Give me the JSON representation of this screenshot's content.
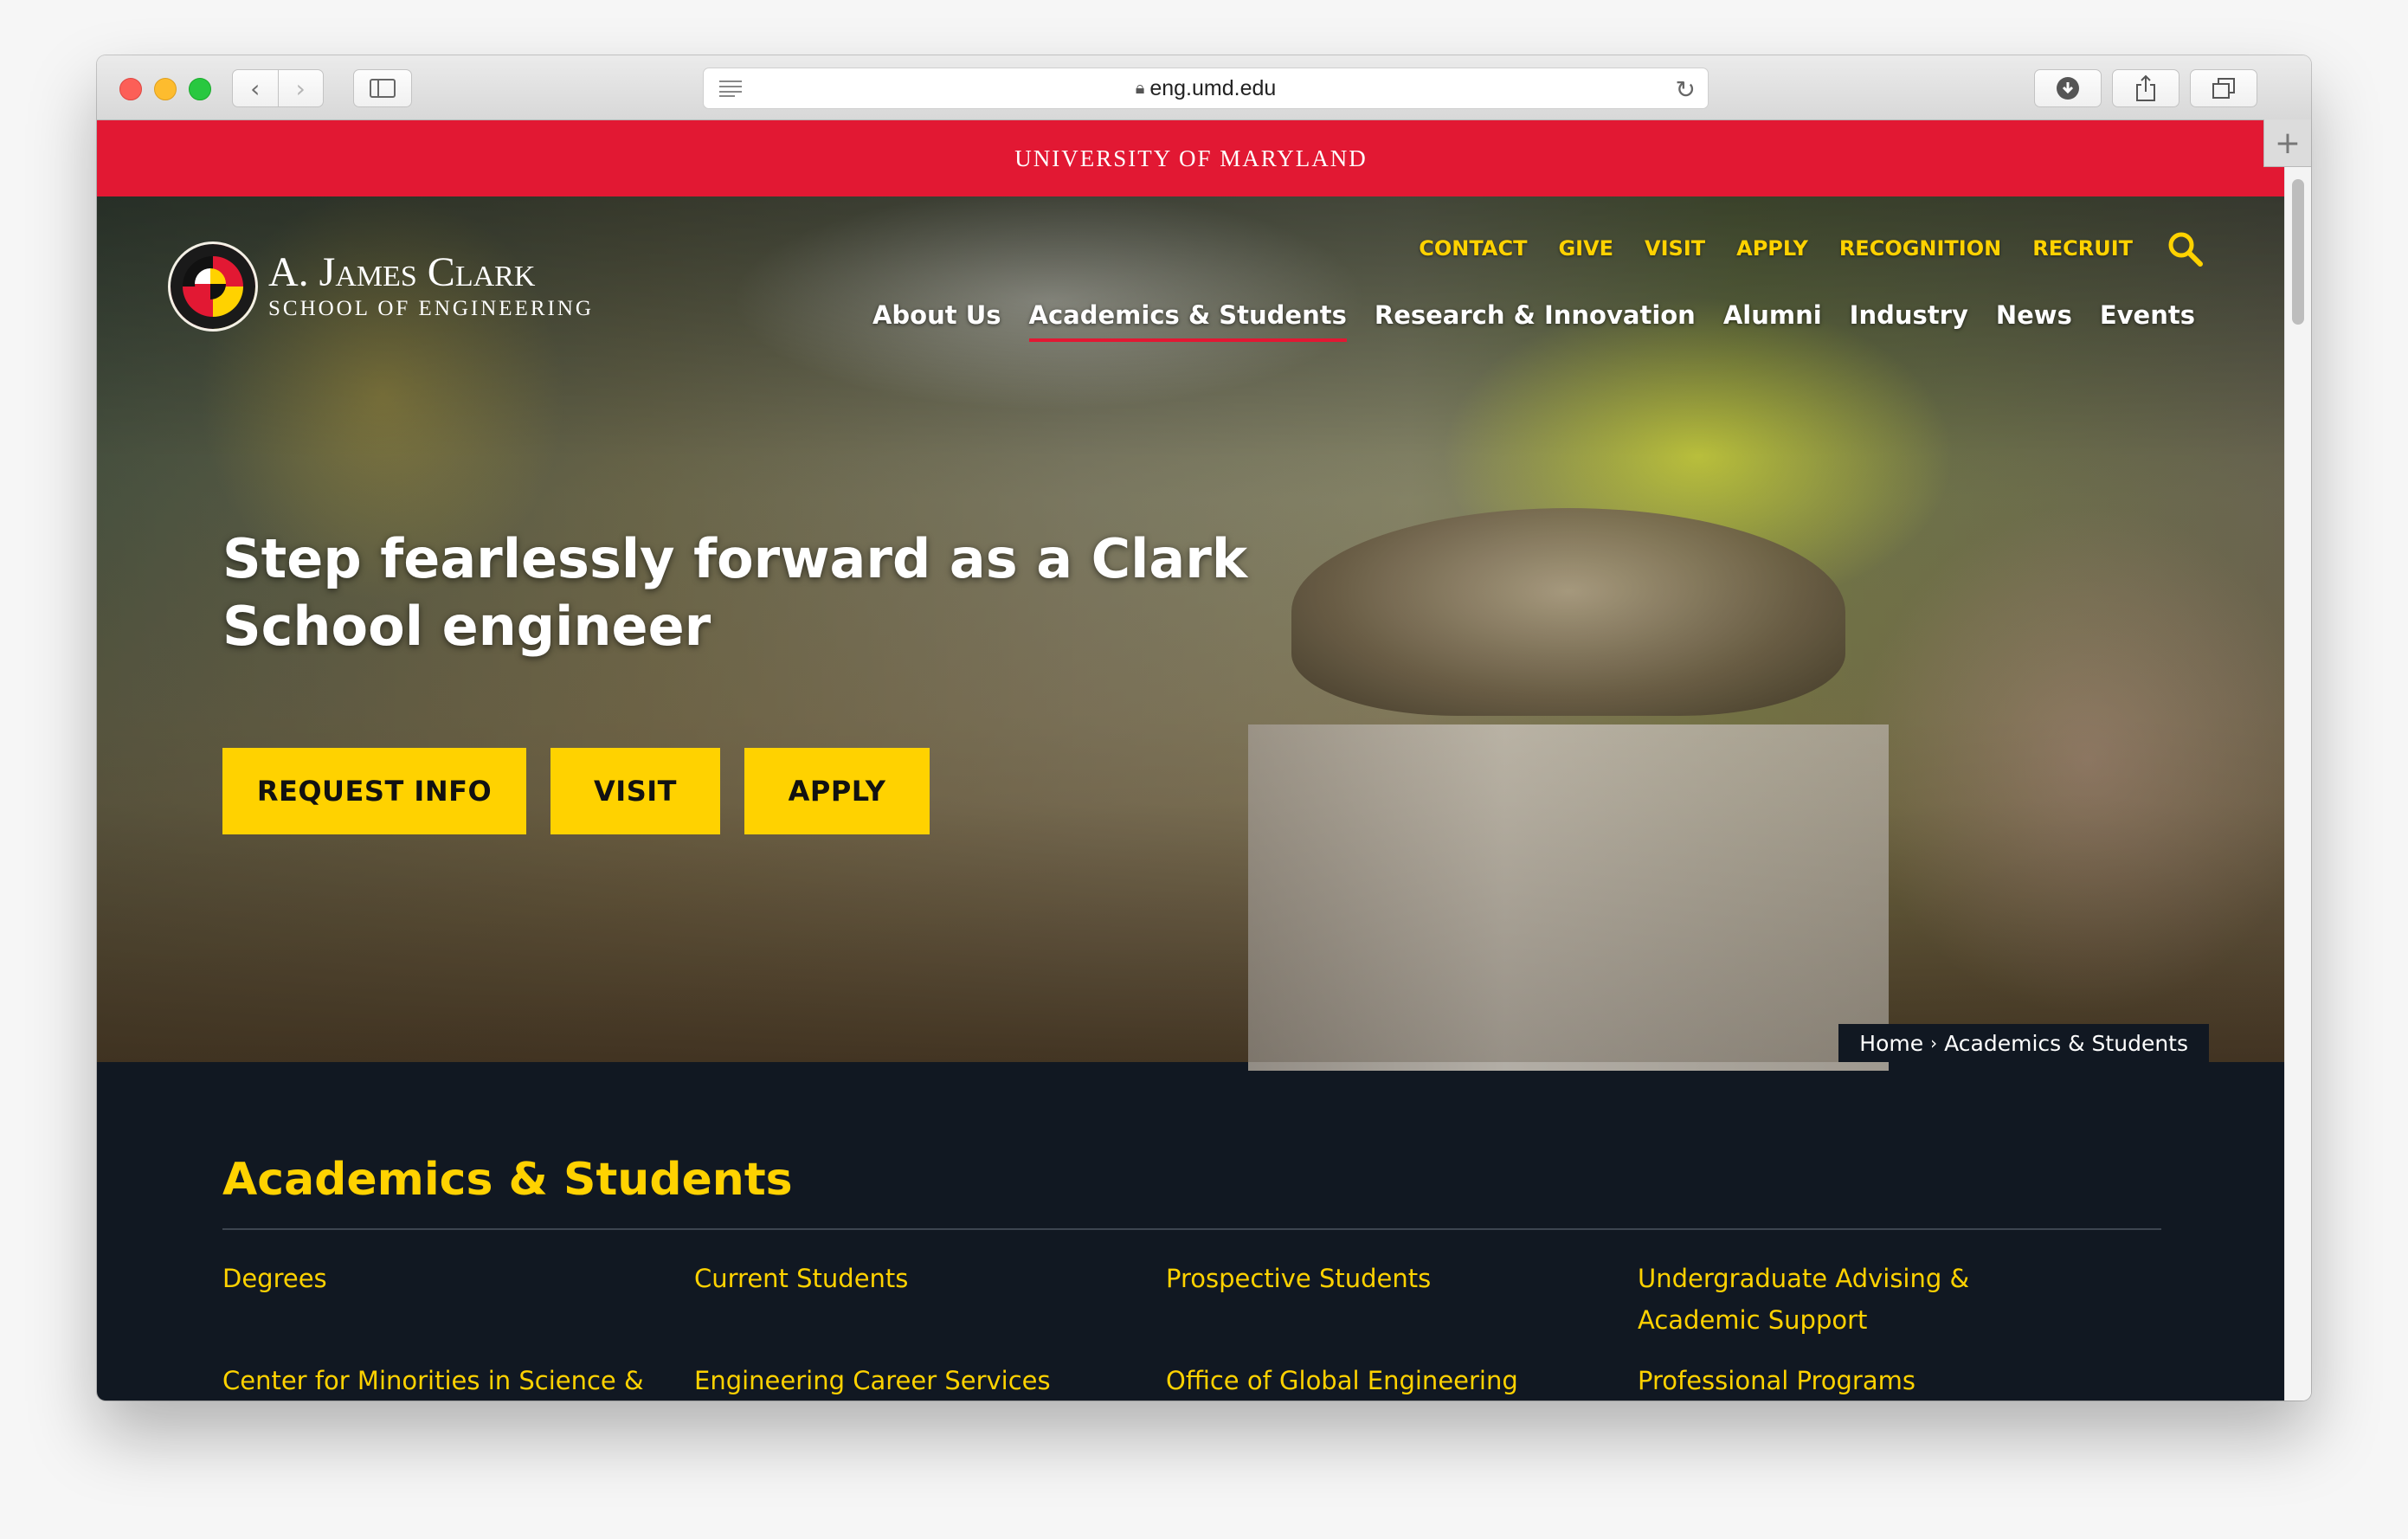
{
  "browser": {
    "url": "eng.umd.edu"
  },
  "site": {
    "topbar": "UNIVERSITY OF MARYLAND",
    "logo": {
      "line1": "A. James Clark",
      "line2": "SCHOOL OF ENGINEERING"
    },
    "utility_nav": [
      "CONTACT",
      "GIVE",
      "VISIT",
      "APPLY",
      "RECOGNITION",
      "RECRUIT"
    ],
    "main_nav": [
      "About Us",
      "Academics & Students",
      "Research & Innovation",
      "Alumni",
      "Industry",
      "News",
      "Events"
    ],
    "active_nav": "Academics & Students"
  },
  "hero": {
    "headline_line1": "Step fearlessly forward as a Clark",
    "headline_line2": "School engineer",
    "buttons": [
      "REQUEST INFO",
      "VISIT",
      "APPLY"
    ],
    "breadcrumb": {
      "home": "Home",
      "separator": "›",
      "current": "Academics & Students"
    }
  },
  "section": {
    "title": "Academics & Students",
    "links": [
      "Degrees",
      "Current Students",
      "Prospective Students",
      "Undergraduate Advising & Academic Support",
      "Center for Minorities in Science &",
      "Engineering Career Services",
      "Office of Global Engineering Leadership",
      "Professional Programs"
    ]
  },
  "colors": {
    "umd_red": "#e21833",
    "umd_gold": "#ffd200",
    "dark_bg": "#111822"
  }
}
